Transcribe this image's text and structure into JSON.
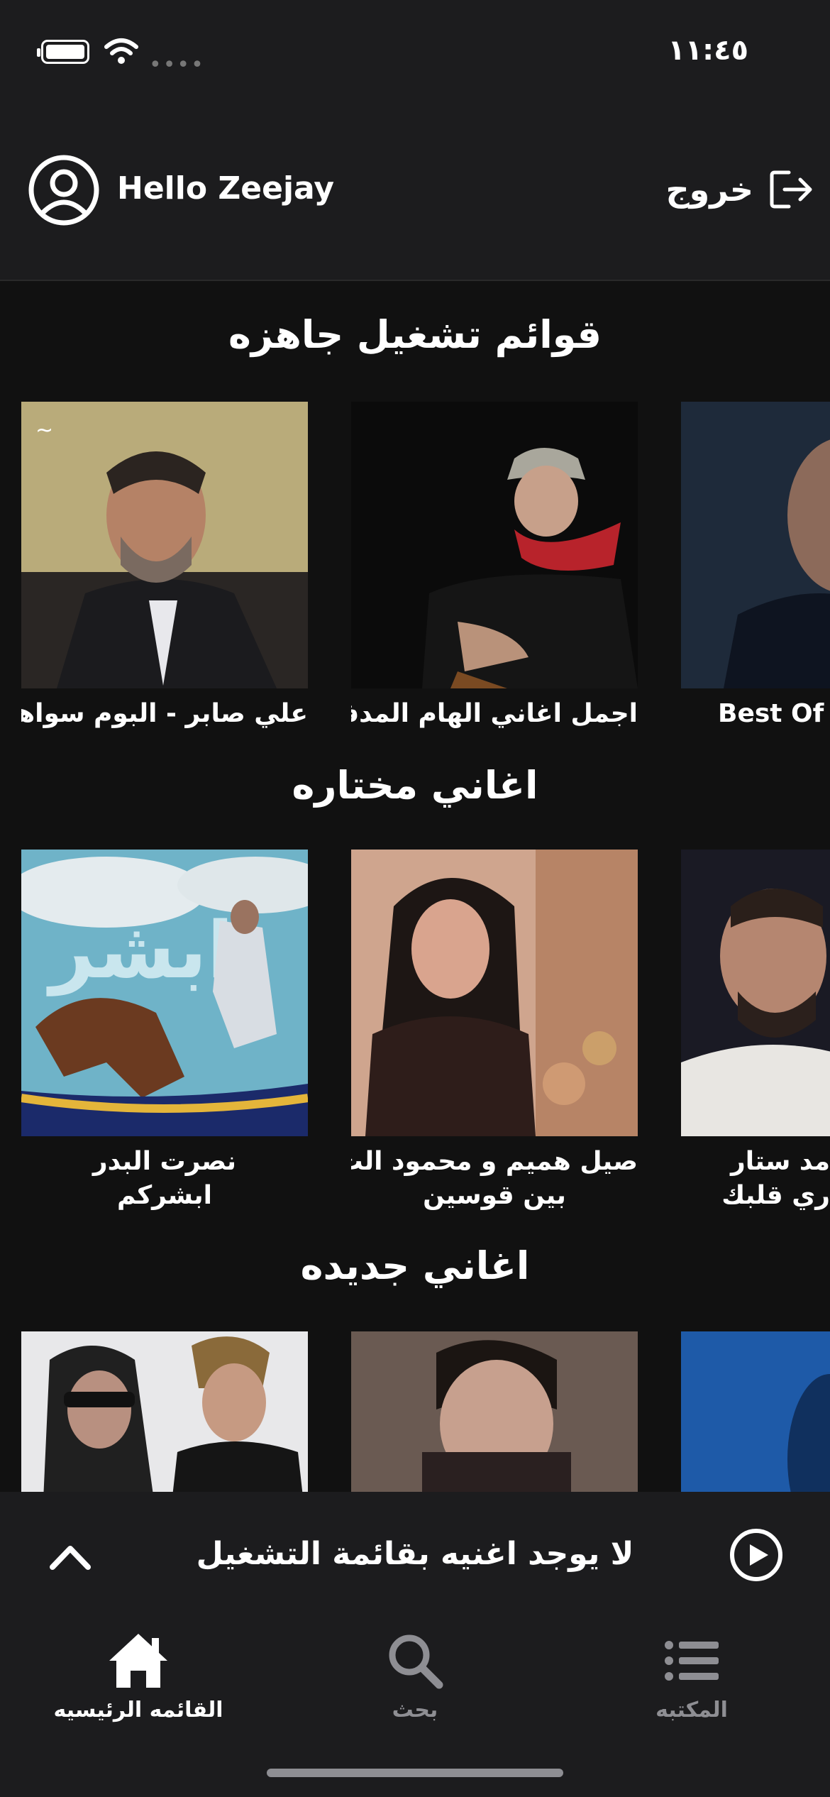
{
  "status_bar": {
    "time": "١١:٤٥"
  },
  "header": {
    "greeting": "Hello Zeejay",
    "logout_label": "خروج"
  },
  "sections": [
    {
      "title": "قوائم تشغيل جاهزه",
      "items": [
        {
          "title": "علي صابر - البوم سواها"
        },
        {
          "title": "اجمل اغاني الهام المدفعي"
        },
        {
          "title": "Best Of"
        }
      ]
    },
    {
      "title": "اغاني مختاره",
      "items": [
        {
          "title": "نصرت البدر",
          "subtitle": "ابشركم"
        },
        {
          "title": "صيل هميم و محمود الت",
          "subtitle": "بين قوسين"
        },
        {
          "title": "مد ستار",
          "subtitle": "ري قلبك"
        }
      ]
    },
    {
      "title": "اغاني جديده",
      "items": [
        {},
        {},
        {}
      ]
    }
  ],
  "player": {
    "empty_text": "لا يوجد اغنيه بقائمة التشغيل"
  },
  "tabs": [
    {
      "label": "القائمه الرئيسيه",
      "icon": "home-icon",
      "active": true
    },
    {
      "label": "بحث",
      "icon": "search-icon",
      "active": false
    },
    {
      "label": "المكتبه",
      "icon": "list-icon",
      "active": false
    }
  ],
  "colors": {
    "background": "#111111",
    "bar": "#1c1c1e",
    "active_tab": "#ffffff",
    "inactive_tab": "#8e8e93"
  }
}
